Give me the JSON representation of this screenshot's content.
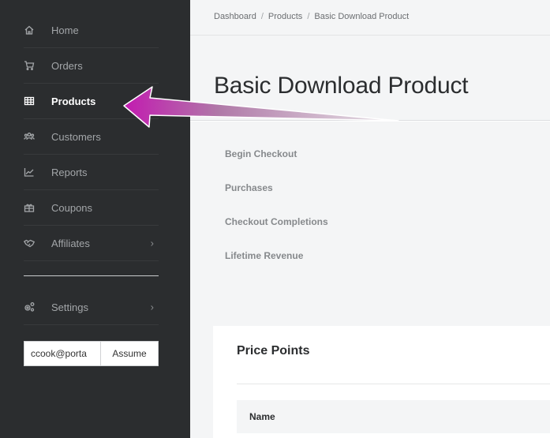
{
  "sidebar": {
    "items": [
      {
        "label": "Home",
        "icon": "home-icon"
      },
      {
        "label": "Orders",
        "icon": "cart-icon"
      },
      {
        "label": "Products",
        "icon": "grid-icon",
        "active": true
      },
      {
        "label": "Customers",
        "icon": "users-icon"
      },
      {
        "label": "Reports",
        "icon": "chart-icon"
      },
      {
        "label": "Coupons",
        "icon": "gift-icon"
      },
      {
        "label": "Affiliates",
        "icon": "handshake-icon",
        "chevron": "›"
      }
    ],
    "settings": {
      "label": "Settings",
      "icon": "gears-icon",
      "chevron": "›"
    },
    "assume": {
      "value": "ccook@porta",
      "button_label": "Assume"
    }
  },
  "breadcrumb": {
    "items": [
      "Dashboard",
      "Products",
      "Basic Download Product"
    ],
    "separator": "/"
  },
  "page": {
    "title": "Basic Download Product"
  },
  "stats": [
    "Begin Checkout",
    "Purchases",
    "Checkout Completions",
    "Lifetime Revenue"
  ],
  "price_points": {
    "title": "Price Points",
    "columns": [
      "Name"
    ]
  },
  "annotation": {
    "arrow_color": "#c21bb0"
  }
}
